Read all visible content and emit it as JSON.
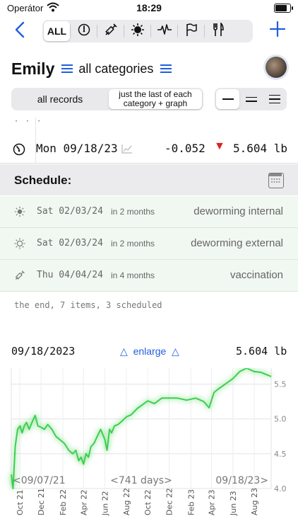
{
  "status": {
    "carrier": "Operátor",
    "time": "18:29",
    "battery_level": 0.9
  },
  "toolbar": {
    "filters": [
      {
        "label": "ALL",
        "icon": "all"
      },
      {
        "icon": "scale-icon"
      },
      {
        "icon": "syringe-icon"
      },
      {
        "icon": "virus-icon"
      },
      {
        "icon": "heartbeat-icon"
      },
      {
        "icon": "flag-icon"
      },
      {
        "icon": "fork-knife-icon"
      }
    ]
  },
  "header": {
    "pet_name": "Emily",
    "category_label": "all categories"
  },
  "view_mode": {
    "option_all": "all records",
    "option_last": "just the last of each category + graph",
    "selected": "last"
  },
  "record": {
    "date": "Mon 09/18/23",
    "delta": "-0.052",
    "value": "5.604 lb",
    "trend_color": "#e02020"
  },
  "schedule": {
    "title": "Schedule:",
    "items": [
      {
        "date": "Sat 02/03/24",
        "in": "in 2 months",
        "name": "deworming internal",
        "icon": "virus-icon"
      },
      {
        "date": "Sat 02/03/24",
        "in": "in 2 months",
        "name": "deworming external",
        "icon": "sun-icon"
      },
      {
        "date": "Thu 04/04/24",
        "in": "in 4 months",
        "name": "vaccination",
        "icon": "syringe-icon"
      }
    ]
  },
  "footer_note": "the end, 7 items, 3 scheduled",
  "chart_header": {
    "date": "09/18/2023",
    "enlarge": "enlarge",
    "value": "5.604 lb"
  },
  "chart_data": {
    "type": "line",
    "series": [
      {
        "x": [
          "2021-09-07",
          "2021-09-12",
          "2021-09-18",
          "2021-09-25",
          "2021-10-02",
          "2021-10-08",
          "2021-10-14",
          "2021-10-20",
          "2021-10-28",
          "2021-11-05",
          "2021-11-14",
          "2021-11-22",
          "2021-12-01",
          "2021-12-10",
          "2021-12-20",
          "2022-01-01",
          "2022-01-12",
          "2022-01-24",
          "2022-02-05",
          "2022-02-18",
          "2022-03-01",
          "2022-03-10",
          "2022-03-18",
          "2022-03-25",
          "2022-04-01",
          "2022-04-08",
          "2022-04-15",
          "2022-04-22",
          "2022-05-01",
          "2022-05-10",
          "2022-05-20",
          "2022-06-01",
          "2022-06-07",
          "2022-06-14",
          "2022-06-20",
          "2022-06-28",
          "2022-07-08",
          "2022-07-20",
          "2022-08-01",
          "2022-08-15",
          "2022-09-01",
          "2022-09-15",
          "2022-10-01",
          "2022-10-20",
          "2022-11-10",
          "2022-12-01",
          "2022-12-25",
          "2023-01-20",
          "2023-02-15",
          "2023-03-10",
          "2023-03-25",
          "2023-04-08",
          "2023-04-20",
          "2023-05-10",
          "2023-06-01",
          "2023-06-20",
          "2023-07-10",
          "2023-08-01",
          "2023-08-20",
          "2023-09-18"
        ],
        "y": [
          4.2,
          4.0,
          4.6,
          4.85,
          4.9,
          4.8,
          4.9,
          4.95,
          4.85,
          4.95,
          5.05,
          4.9,
          4.88,
          4.85,
          4.92,
          4.85,
          4.75,
          4.7,
          4.65,
          4.55,
          4.5,
          4.55,
          4.4,
          4.45,
          4.35,
          4.5,
          4.45,
          4.6,
          4.65,
          4.75,
          4.85,
          4.7,
          4.55,
          4.85,
          4.8,
          4.9,
          4.92,
          4.97,
          5.03,
          5.06,
          5.15,
          5.2,
          5.26,
          5.22,
          5.3,
          5.3,
          5.3,
          5.27,
          5.3,
          5.25,
          5.16,
          5.38,
          5.43,
          5.5,
          5.58,
          5.68,
          5.73,
          5.68,
          5.67,
          5.61
        ]
      }
    ],
    "y_ticks": [
      "5.5",
      "5.0",
      "4.5",
      "4.0"
    ],
    "ylim": [
      4.0,
      5.73
    ],
    "x_ticks": [
      "Oct 21",
      "Dec 21",
      "Feb 22",
      "Apr 22",
      "Jun 22",
      "Aug 22",
      "Oct 22",
      "Dec 22",
      "Feb 23",
      "Apr 23",
      "Jun 23",
      "Aug 23"
    ],
    "range_start": "<09/07/21",
    "range_days": "<741 days>",
    "range_end": "09/18/23>",
    "line_color": "#3ccf4e",
    "grid": true
  }
}
